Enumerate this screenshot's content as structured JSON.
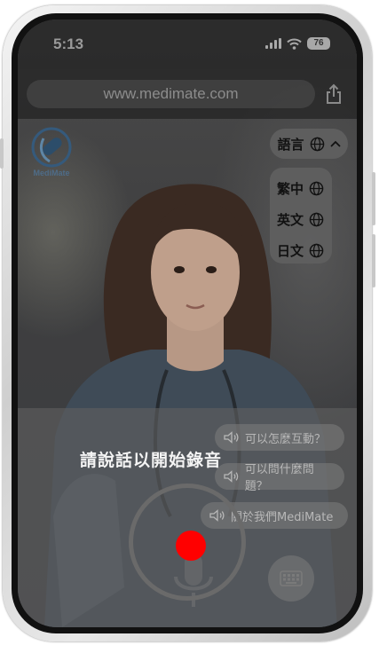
{
  "status_bar": {
    "time": "5:13",
    "battery": "76"
  },
  "browser": {
    "url": "www.medimate.com"
  },
  "brand": {
    "logo_text": "MediMate"
  },
  "language": {
    "button_label": "語言",
    "options": [
      "繁中",
      "英文",
      "日文"
    ]
  },
  "quick_questions": [
    "可以怎麼互動？",
    "可以問什麼問題？",
    "關於我們MediMate"
  ],
  "recording": {
    "prompt": "請說話以開始錄音"
  },
  "icons": {
    "globe": "globe-icon",
    "chevron": "chevron-up-icon",
    "speaker": "speaker-icon",
    "keyboard": "keyboard-icon",
    "share": "share-icon",
    "mic": "microphone-icon"
  },
  "colors": {
    "record": "#ff0000",
    "overlay": "#5f5f5f",
    "logo_blue": "#4e6c88"
  }
}
